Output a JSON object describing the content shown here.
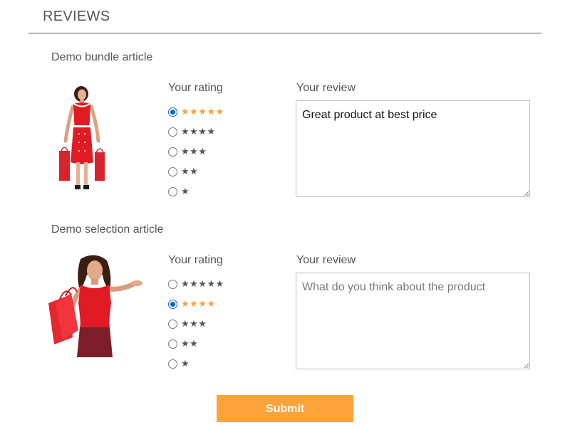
{
  "header": {
    "title": "REVIEWS"
  },
  "articles": [
    {
      "name": "Demo bundle article",
      "rating_label": "Your rating",
      "review_label": "Your review",
      "rating_options": [
        {
          "stars": "★★★★★",
          "value": 5,
          "selected": true
        },
        {
          "stars": "★★★★",
          "value": 4,
          "selected": false
        },
        {
          "stars": "★★★",
          "value": 3,
          "selected": false
        },
        {
          "stars": "★★",
          "value": 2,
          "selected": false
        },
        {
          "stars": "★",
          "value": 1,
          "selected": false
        }
      ],
      "selected_rating": 5,
      "review_value": "Great product at best price",
      "review_placeholder": "",
      "image_icon": "woman-red-dress-shopping-bags"
    },
    {
      "name": "Demo selection article",
      "rating_label": "Your rating",
      "review_label": "Your review",
      "rating_options": [
        {
          "stars": "★★★★★",
          "value": 5,
          "selected": false
        },
        {
          "stars": "★★★★",
          "value": 4,
          "selected": true
        },
        {
          "stars": "★★★",
          "value": 3,
          "selected": false
        },
        {
          "stars": "★★",
          "value": 2,
          "selected": false
        },
        {
          "stars": "★",
          "value": 1,
          "selected": false
        }
      ],
      "selected_rating": 4,
      "review_value": "",
      "review_placeholder": "What do you think about the product",
      "image_icon": "woman-red-top-shopping-bags"
    }
  ],
  "submit": {
    "label": "Submit"
  },
  "colors": {
    "accent": "#fda33a",
    "star_active": "#f7a336",
    "radio_checked": "#0b63d6",
    "text": "#555555"
  }
}
